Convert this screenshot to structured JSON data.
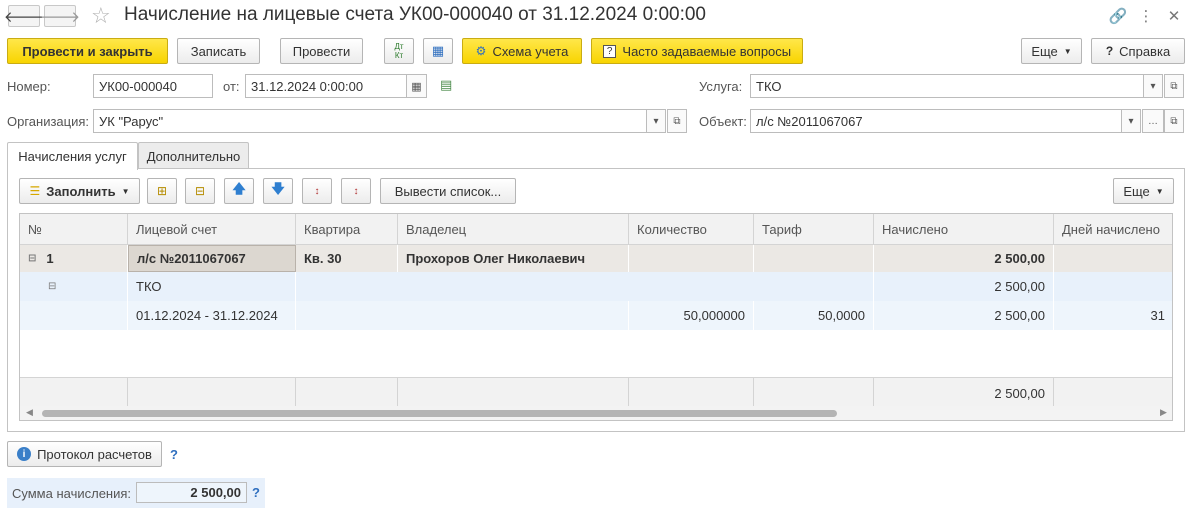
{
  "window": {
    "title": "Начисление на лицевые счета УК00-000040 от 31.12.2024 0:00:00",
    "back_icon": "arrow-left-icon",
    "forward_icon": "arrow-right-icon",
    "favorite_icon": "star-icon"
  },
  "toolbar": {
    "post_close": "Провести и закрыть",
    "save": "Записать",
    "post": "Провести",
    "dt_kt_top": "Дт",
    "dt_kt_bottom": "Кт",
    "scheme": "Схема учета",
    "faq": "Часто задаваемые вопросы",
    "more": "Еще",
    "help": "Справка"
  },
  "form": {
    "number_label": "Номер:",
    "number_value": "УК00-000040",
    "date_label": "от:",
    "date_value": "31.12.2024  0:00:00",
    "org_label": "Организация:",
    "org_value": "УК \"Рарус\"",
    "service_label": "Услуга:",
    "service_value": "ТКО",
    "object_label": "Объект:",
    "object_value": "л/с №2011067067"
  },
  "tabs": [
    {
      "label": "Начисления услуг",
      "active": true
    },
    {
      "label": "Дополнительно",
      "active": false
    }
  ],
  "grid_toolbar": {
    "fill": "Заполнить",
    "output_list": "Вывести список...",
    "more": "Еще"
  },
  "grid": {
    "columns": [
      "№",
      "Лицевой счет",
      "Квартира",
      "Владелец",
      "Количество",
      "Тариф",
      "Начислено",
      "Дней начислено"
    ],
    "group_row": {
      "num": "1",
      "account": "л/с №2011067067",
      "apartment": "Кв. 30",
      "owner": "Прохоров Олег Николаевич",
      "accrued": "2 500,00"
    },
    "service_row": {
      "service": "ТКО",
      "accrued": "2 500,00"
    },
    "period_row": {
      "period": "01.12.2024 - 31.12.2024",
      "quantity": "50,000000",
      "tariff": "50,0000",
      "accrued": "2 500,00",
      "days": "31"
    },
    "footer": {
      "accrued_total": "2 500,00"
    }
  },
  "bottom": {
    "protocol": "Протокол расчетов",
    "sum_label": "Сумма начисления:",
    "sum_value": "2 500,00",
    "help_mark": "?"
  },
  "colors": {
    "accent_yellow": "#f8d400",
    "selected_row": "#e8f1fb",
    "group_row": "#ebe8e4"
  }
}
